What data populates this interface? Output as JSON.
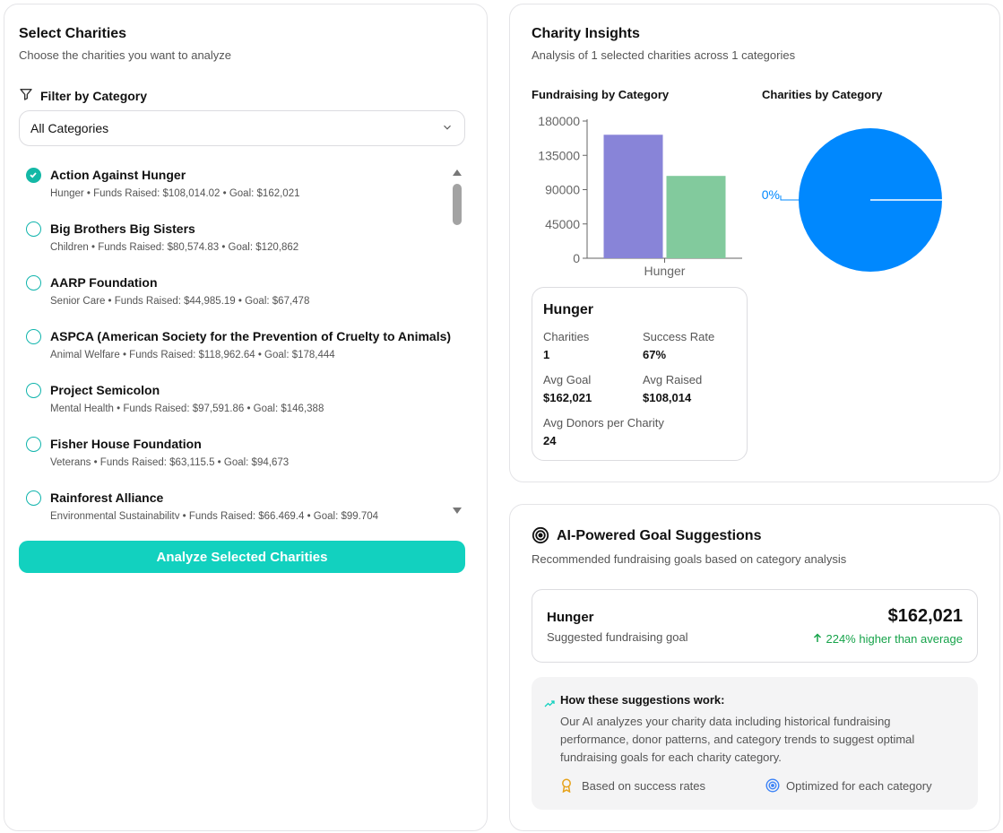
{
  "select_panel": {
    "title": "Select Charities",
    "subtitle": "Choose the charities you want to analyze",
    "filter_label": "Filter by Category",
    "category_select": "All Categories",
    "charities": [
      {
        "name": "Action Against Hunger",
        "meta": "Hunger • Funds Raised: $108,014.02 • Goal: $162,021",
        "selected": true
      },
      {
        "name": "Big Brothers Big Sisters",
        "meta": "Children • Funds Raised: $80,574.83 • Goal: $120,862",
        "selected": false
      },
      {
        "name": "AARP Foundation",
        "meta": "Senior Care • Funds Raised: $44,985.19 • Goal: $67,478",
        "selected": false
      },
      {
        "name": "ASPCA (American Society for the Prevention of Cruelty to Animals)",
        "meta": "Animal Welfare • Funds Raised: $118,962.64 • Goal: $178,444",
        "selected": false
      },
      {
        "name": "Project Semicolon",
        "meta": "Mental Health • Funds Raised: $97,591.86 • Goal: $146,388",
        "selected": false
      },
      {
        "name": "Fisher House Foundation",
        "meta": "Veterans • Funds Raised: $63,115.5 • Goal: $94,673",
        "selected": false
      },
      {
        "name": "Rainforest Alliance",
        "meta": "Environmental Sustainability • Funds Raised: $66,469.4 • Goal: $99,704",
        "selected": false
      }
    ],
    "analyze_button": "Analyze Selected Charities"
  },
  "insights": {
    "title": "Charity Insights",
    "subtitle": "Analysis of 1 selected charities across 1 categories",
    "bar_heading": "Fundraising by Category",
    "pie_heading": "Charities by Category",
    "stat_card": {
      "category": "Hunger",
      "charities_label": "Charities",
      "charities_value": "1",
      "success_label": "Success Rate",
      "success_value": "67%",
      "avg_goal_label": "Avg Goal",
      "avg_goal_value": "$162,021",
      "avg_raised_label": "Avg Raised",
      "avg_raised_value": "$108,014",
      "avg_donors_label": "Avg Donors per Charity",
      "avg_donors_value": "24"
    }
  },
  "chart_data": [
    {
      "type": "bar",
      "categories": [
        "Hunger"
      ],
      "series": [
        {
          "values": [
            162021
          ],
          "color": "#8884d8"
        },
        {
          "values": [
            108014
          ],
          "color": "#82ca9d"
        }
      ],
      "yticks": [
        "0",
        "45000",
        "90000",
        "135000",
        "180000"
      ],
      "ylim": [
        0,
        180000
      ]
    },
    {
      "type": "pie",
      "slices": [
        {
          "label": "0%",
          "value": 1,
          "color": "#0088fe"
        }
      ]
    }
  ],
  "ai_panel": {
    "title": "AI-Powered Goal Suggestions",
    "subtitle": "Recommended fundraising goals based on category analysis",
    "suggestion": {
      "category": "Hunger",
      "label": "Suggested fundraising goal",
      "amount": "$162,021",
      "delta": "224% higher than average"
    },
    "how": {
      "title": "How these suggestions work:",
      "text": "Our AI analyzes your charity data including historical fundraising performance, donor patterns, and category trends to suggest optimal fundraising goals for each charity category.",
      "feature_1": "Based on success rates",
      "feature_2": "Optimized for each category"
    }
  },
  "colors": {
    "accent": "#12d1bf",
    "positive": "#16a34a",
    "bar_goal": "#8884d8",
    "bar_raised": "#82ca9d",
    "pie": "#0088fe"
  }
}
